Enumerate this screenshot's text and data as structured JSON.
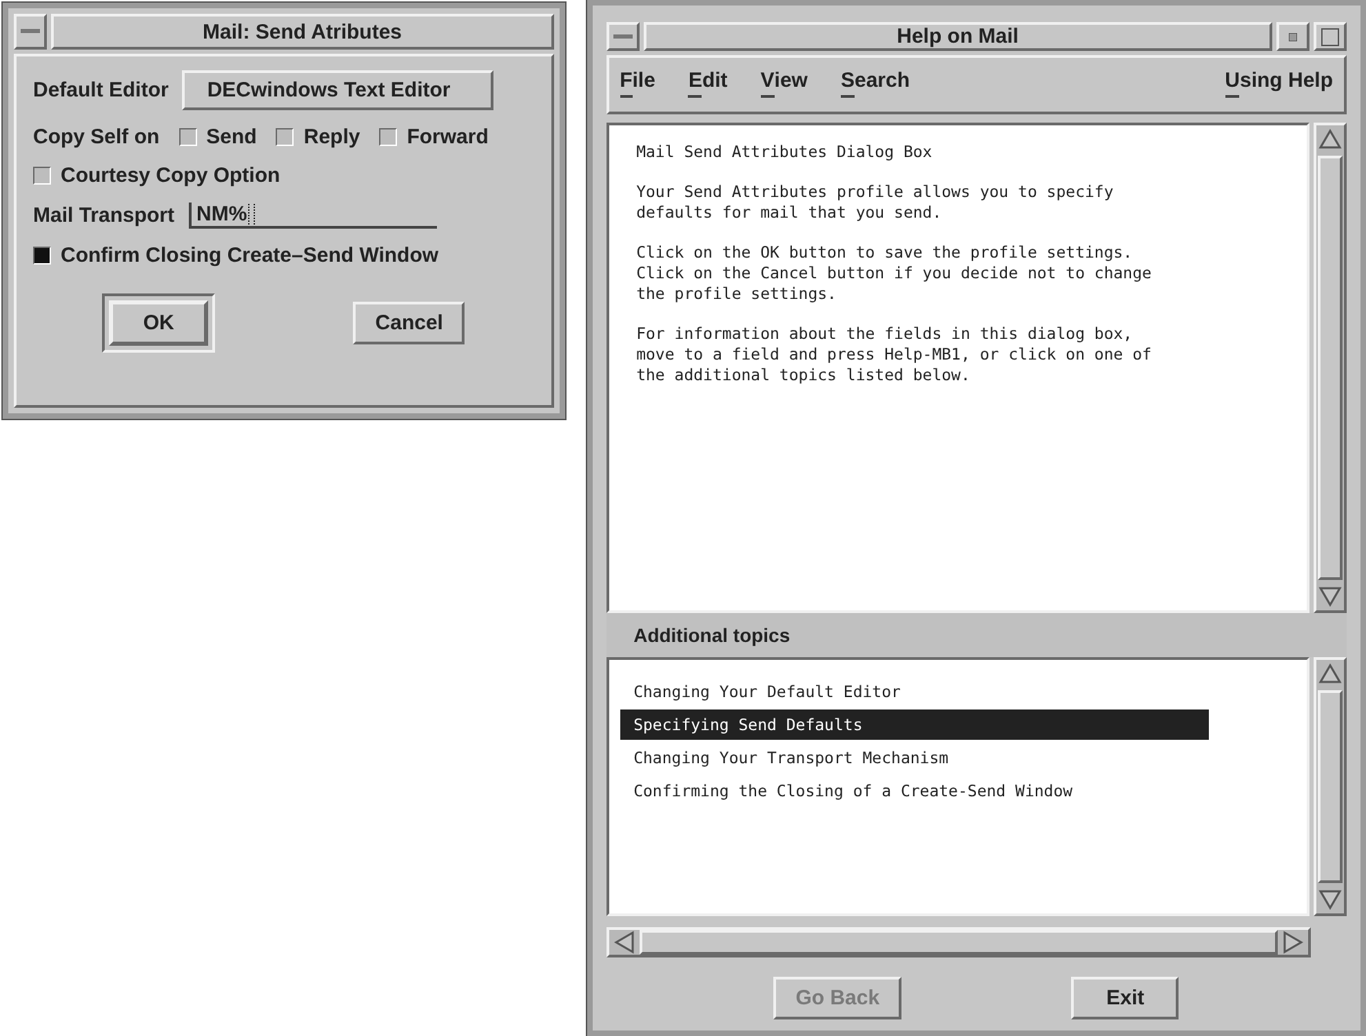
{
  "send_dialog": {
    "title": "Mail: Send Atributes",
    "default_editor": {
      "label": "Default Editor",
      "value": "DECwindows Text Editor"
    },
    "copy_self": {
      "label": "Copy Self on",
      "options": [
        {
          "label": "Send",
          "checked": false
        },
        {
          "label": "Reply",
          "checked": false
        },
        {
          "label": "Forward",
          "checked": false
        }
      ]
    },
    "courtesy_copy": {
      "label": "Courtesy Copy Option",
      "checked": false
    },
    "mail_transport": {
      "label": "Mail Transport",
      "value": "NM%"
    },
    "confirm_closing": {
      "label": "Confirm Closing Create–Send Window",
      "checked": true
    },
    "buttons": [
      {
        "label": "OK",
        "default": true
      },
      {
        "label": "Cancel",
        "default": false
      }
    ]
  },
  "help_window": {
    "title": "Help on Mail",
    "menu": [
      {
        "label": "File"
      },
      {
        "label": "Edit"
      },
      {
        "label": "View"
      },
      {
        "label": "Search"
      },
      {
        "label": "Using Help"
      }
    ],
    "paragraphs": [
      "Mail Send Attributes Dialog Box",
      "Your Send Attributes profile allows you to specify\ndefaults for mail that you send.",
      "Click on the OK button to save the profile settings.\nClick on the Cancel button if you decide not to change\nthe profile settings.",
      "For information about the fields in this dialog box,\nmove to a field and press Help-MB1, or click on one of\nthe additional topics listed below."
    ],
    "topics_heading": "Additional topics",
    "topics": [
      {
        "label": "Changing Your Default Editor",
        "selected": false
      },
      {
        "label": "Specifying Send Defaults",
        "selected": true
      },
      {
        "label": "Changing Your Transport Mechanism",
        "selected": false
      },
      {
        "label": "Confirming the Closing of a Create-Send Window",
        "selected": false
      }
    ],
    "buttons": [
      {
        "label": "Go Back",
        "disabled": true
      },
      {
        "label": "Exit",
        "disabled": false
      }
    ]
  }
}
